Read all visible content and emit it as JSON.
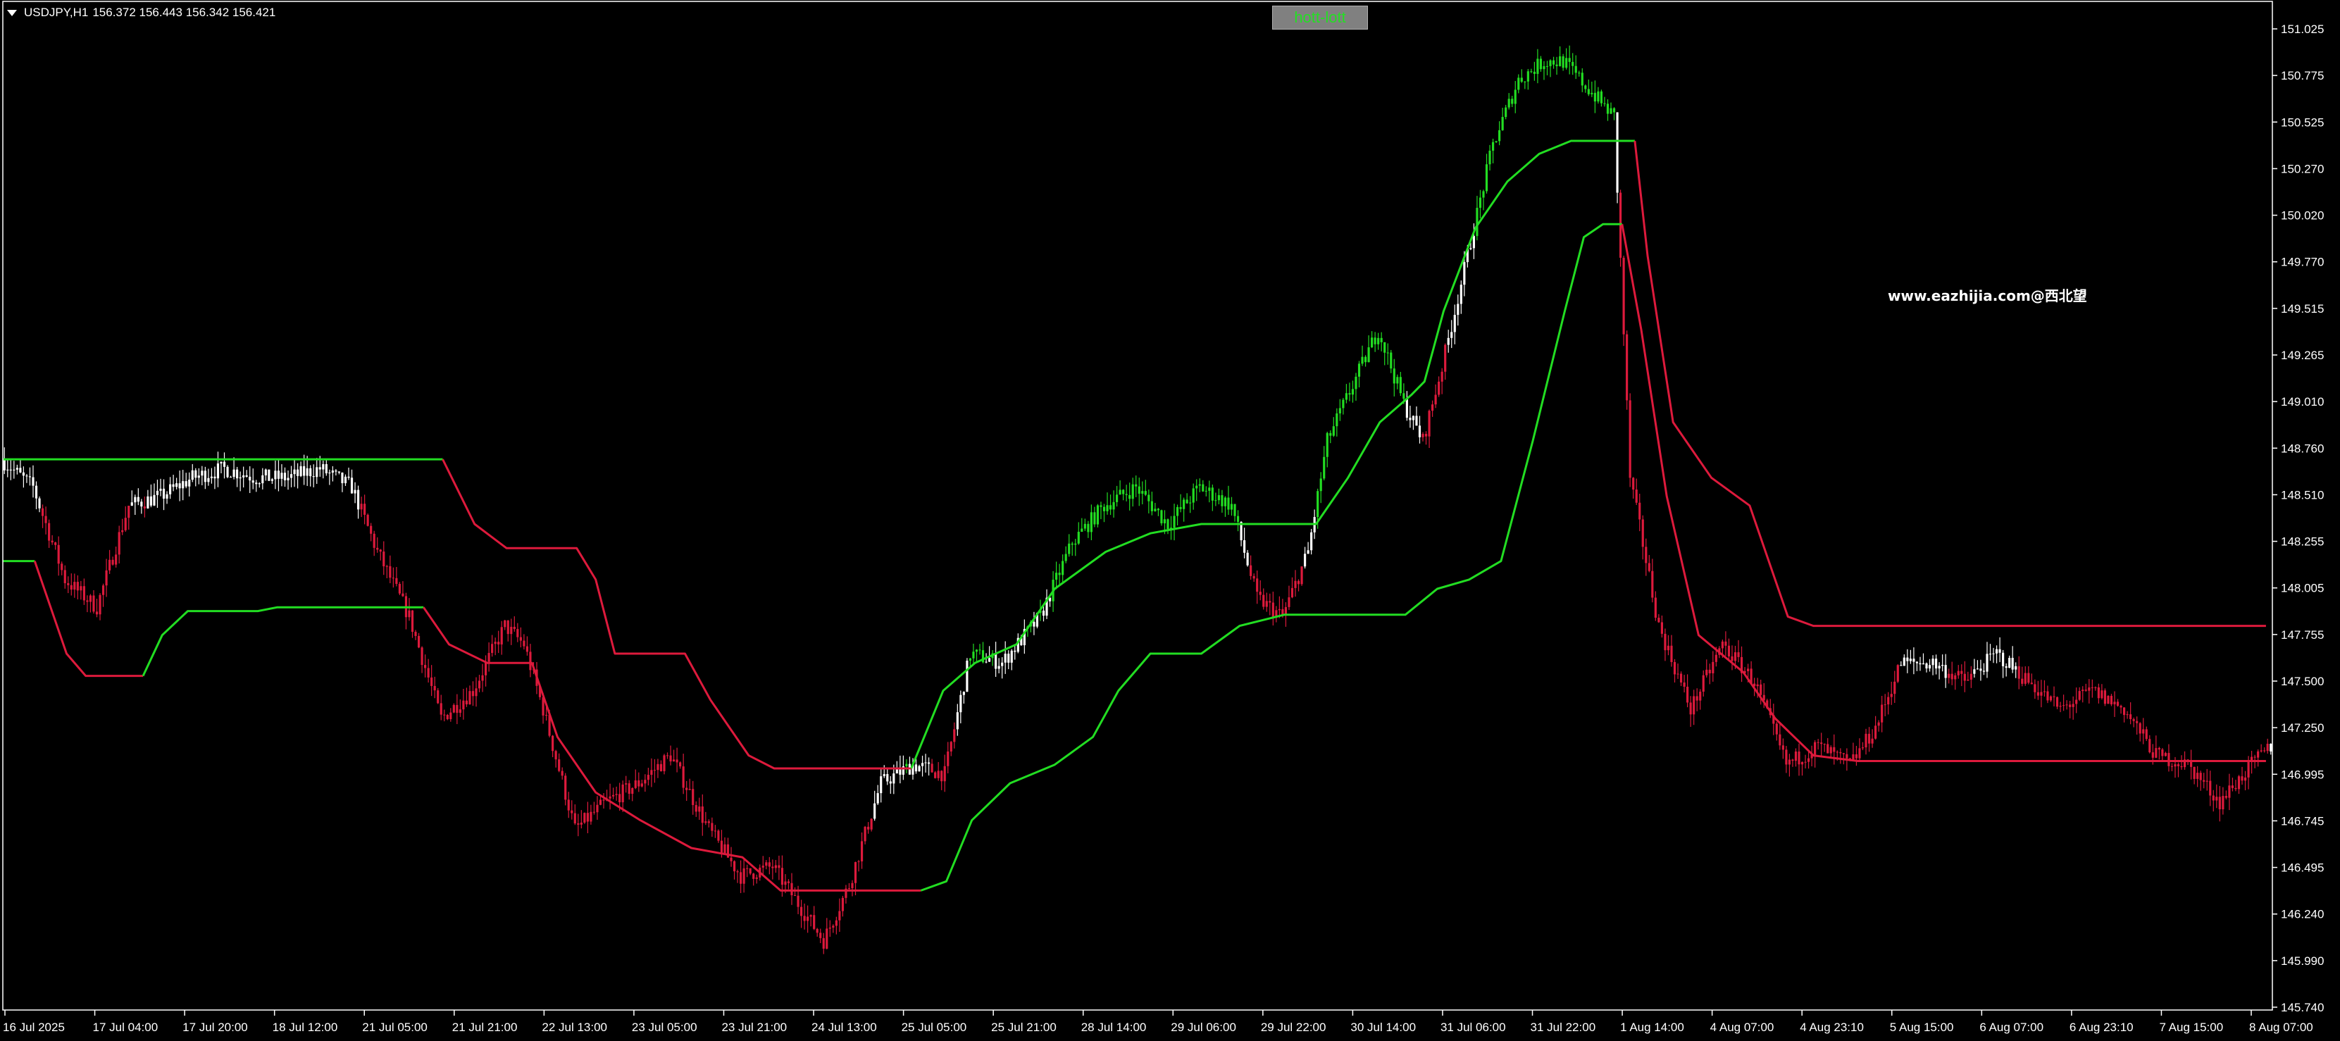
{
  "header": {
    "symbol": "USDJPY,H1",
    "quote": "156.372 156.443 156.342 156.421"
  },
  "indicator_button": {
    "label": "hott-lott"
  },
  "watermark": {
    "text": "www.eazhijia.com@西北望"
  },
  "colors": {
    "background": "#000000",
    "bull_candle": "#22dd22",
    "bear_candle": "#dd1a3c",
    "white_candle": "#ffffff",
    "axis": "#ffffff",
    "line_green": "#22dd22",
    "line_red": "#dd1a3c"
  },
  "chart_data": {
    "type": "candlestick",
    "symbol": "USDJPY",
    "timeframe": "H1",
    "ylim": [
      145.74,
      151.025
    ],
    "y_ticks": [
      "151.025",
      "150.775",
      "150.525",
      "150.270",
      "150.020",
      "149.770",
      "149.515",
      "149.265",
      "149.010",
      "148.760",
      "148.510",
      "148.255",
      "148.005",
      "147.755",
      "147.500",
      "147.250",
      "146.995",
      "146.745",
      "146.495",
      "146.240",
      "145.990",
      "145.740"
    ],
    "x_ticks": [
      "16 Jul 2025",
      "17 Jul 04:00",
      "17 Jul 20:00",
      "18 Jul 12:00",
      "21 Jul 05:00",
      "21 Jul 21:00",
      "22 Jul 13:00",
      "23 Jul 05:00",
      "23 Jul 21:00",
      "24 Jul 13:00",
      "25 Jul 05:00",
      "25 Jul 21:00",
      "28 Jul 14:00",
      "29 Jul 06:00",
      "29 Jul 22:00",
      "30 Jul 14:00",
      "31 Jul 06:00",
      "31 Jul 22:00",
      "1 Aug 14:00",
      "4 Aug 07:00",
      "4 Aug 23:10",
      "5 Aug 15:00",
      "6 Aug 07:00",
      "6 Aug 23:10",
      "7 Aug 15:00",
      "8 Aug 07:00"
    ],
    "price_path": [
      [
        0,
        148.7
      ],
      [
        10,
        148.55
      ],
      [
        20,
        148.05
      ],
      [
        30,
        147.9
      ],
      [
        40,
        148.45
      ],
      [
        50,
        148.5
      ],
      [
        60,
        148.6
      ],
      [
        70,
        148.65
      ],
      [
        80,
        148.6
      ],
      [
        90,
        148.6
      ],
      [
        100,
        148.65
      ],
      [
        110,
        148.55
      ],
      [
        118,
        148.2
      ],
      [
        128,
        147.85
      ],
      [
        138,
        147.3
      ],
      [
        148,
        147.45
      ],
      [
        158,
        147.8
      ],
      [
        164,
        147.7
      ],
      [
        170,
        147.35
      ],
      [
        180,
        146.7
      ],
      [
        190,
        146.85
      ],
      [
        200,
        146.95
      ],
      [
        210,
        147.1
      ],
      [
        222,
        146.7
      ],
      [
        232,
        146.45
      ],
      [
        242,
        146.5
      ],
      [
        250,
        146.3
      ],
      [
        258,
        146.1
      ],
      [
        266,
        146.4
      ],
      [
        276,
        146.95
      ],
      [
        286,
        147.05
      ],
      [
        296,
        147.0
      ],
      [
        304,
        147.65
      ],
      [
        314,
        147.6
      ],
      [
        326,
        147.85
      ],
      [
        336,
        148.25
      ],
      [
        346,
        148.45
      ],
      [
        356,
        148.55
      ],
      [
        366,
        148.35
      ],
      [
        376,
        148.55
      ],
      [
        386,
        148.45
      ],
      [
        394,
        147.95
      ],
      [
        402,
        147.85
      ],
      [
        410,
        148.2
      ],
      [
        416,
        148.8
      ],
      [
        424,
        149.1
      ],
      [
        432,
        149.4
      ],
      [
        440,
        149.0
      ],
      [
        446,
        148.8
      ],
      [
        452,
        149.2
      ],
      [
        460,
        149.8
      ],
      [
        468,
        150.4
      ],
      [
        476,
        150.75
      ],
      [
        484,
        150.85
      ],
      [
        490,
        150.85
      ],
      [
        498,
        150.7
      ],
      [
        506,
        150.55
      ],
      [
        511,
        148.6
      ],
      [
        520,
        147.8
      ],
      [
        530,
        147.35
      ],
      [
        540,
        147.7
      ],
      [
        550,
        147.5
      ],
      [
        560,
        147.05
      ],
      [
        570,
        147.15
      ],
      [
        580,
        147.05
      ],
      [
        588,
        147.25
      ],
      [
        596,
        147.6
      ],
      [
        606,
        147.6
      ],
      [
        616,
        147.5
      ],
      [
        626,
        147.65
      ],
      [
        636,
        147.5
      ],
      [
        646,
        147.35
      ],
      [
        656,
        147.45
      ],
      [
        666,
        147.35
      ],
      [
        676,
        147.1
      ],
      [
        686,
        147.05
      ],
      [
        696,
        146.85
      ],
      [
        706,
        147.05
      ],
      [
        712,
        147.15
      ]
    ],
    "series": [
      {
        "name": "hott",
        "segments": [
          {
            "trend": "up",
            "points": [
              [
                0,
                148.7
              ],
              [
                138,
                148.7
              ]
            ]
          },
          {
            "trend": "down",
            "points": [
              [
                138,
                148.7
              ],
              [
                148,
                148.35
              ],
              [
                158,
                148.22
              ],
              [
                180,
                148.22
              ],
              [
                186,
                148.05
              ],
              [
                192,
                147.65
              ],
              [
                214,
                147.65
              ],
              [
                222,
                147.4
              ],
              [
                234,
                147.1
              ],
              [
                242,
                147.03
              ],
              [
                285,
                147.03
              ]
            ]
          },
          {
            "trend": "up",
            "points": [
              [
                285,
                147.03
              ],
              [
                295,
                147.45
              ],
              [
                305,
                147.6
              ],
              [
                318,
                147.7
              ],
              [
                330,
                148.0
              ],
              [
                346,
                148.2
              ],
              [
                360,
                148.3
              ],
              [
                376,
                148.35
              ],
              [
                412,
                148.35
              ],
              [
                422,
                148.6
              ],
              [
                432,
                148.9
              ],
              [
                442,
                149.05
              ],
              [
                446,
                149.12
              ],
              [
                452,
                149.5
              ],
              [
                462,
                149.95
              ],
              [
                472,
                150.2
              ],
              [
                482,
                150.35
              ],
              [
                492,
                150.42
              ],
              [
                512,
                150.42
              ]
            ]
          },
          {
            "trend": "down",
            "points": [
              [
                512,
                150.42
              ],
              [
                516,
                149.8
              ],
              [
                524,
                148.9
              ],
              [
                536,
                148.6
              ],
              [
                548,
                148.45
              ],
              [
                560,
                147.85
              ],
              [
                568,
                147.8
              ],
              [
                710,
                147.8
              ]
            ]
          }
        ]
      },
      {
        "name": "lott",
        "segments": [
          {
            "trend": "up",
            "points": [
              [
                0,
                148.15
              ],
              [
                10,
                148.15
              ]
            ]
          },
          {
            "trend": "down",
            "points": [
              [
                10,
                148.15
              ],
              [
                20,
                147.65
              ],
              [
                26,
                147.53
              ],
              [
                44,
                147.53
              ]
            ]
          },
          {
            "trend": "up",
            "points": [
              [
                44,
                147.53
              ],
              [
                50,
                147.75
              ],
              [
                58,
                147.88
              ],
              [
                80,
                147.88
              ],
              [
                86,
                147.9
              ],
              [
                132,
                147.9
              ]
            ]
          },
          {
            "trend": "down",
            "points": [
              [
                132,
                147.9
              ],
              [
                140,
                147.7
              ],
              [
                152,
                147.6
              ],
              [
                166,
                147.6
              ],
              [
                174,
                147.2
              ],
              [
                186,
                146.9
              ],
              [
                200,
                146.75
              ],
              [
                216,
                146.6
              ],
              [
                232,
                146.55
              ],
              [
                244,
                146.37
              ],
              [
                288,
                146.37
              ]
            ]
          },
          {
            "trend": "up",
            "points": [
              [
                288,
                146.37
              ],
              [
                296,
                146.42
              ],
              [
                304,
                146.75
              ],
              [
                316,
                146.95
              ],
              [
                330,
                147.05
              ],
              [
                342,
                147.2
              ],
              [
                350,
                147.45
              ],
              [
                360,
                147.65
              ],
              [
                376,
                147.65
              ],
              [
                388,
                147.8
              ],
              [
                402,
                147.86
              ],
              [
                440,
                147.86
              ],
              [
                450,
                148.0
              ],
              [
                460,
                148.05
              ],
              [
                470,
                148.15
              ],
              [
                480,
                148.8
              ],
              [
                490,
                149.5
              ],
              [
                496,
                149.9
              ],
              [
                502,
                149.97
              ],
              [
                508,
                149.97
              ]
            ]
          },
          {
            "trend": "down",
            "points": [
              [
                508,
                149.97
              ],
              [
                514,
                149.4
              ],
              [
                522,
                148.5
              ],
              [
                532,
                147.75
              ],
              [
                546,
                147.55
              ],
              [
                556,
                147.3
              ],
              [
                568,
                147.1
              ],
              [
                582,
                147.07
              ],
              [
                710,
                147.07
              ]
            ]
          }
        ]
      }
    ]
  }
}
